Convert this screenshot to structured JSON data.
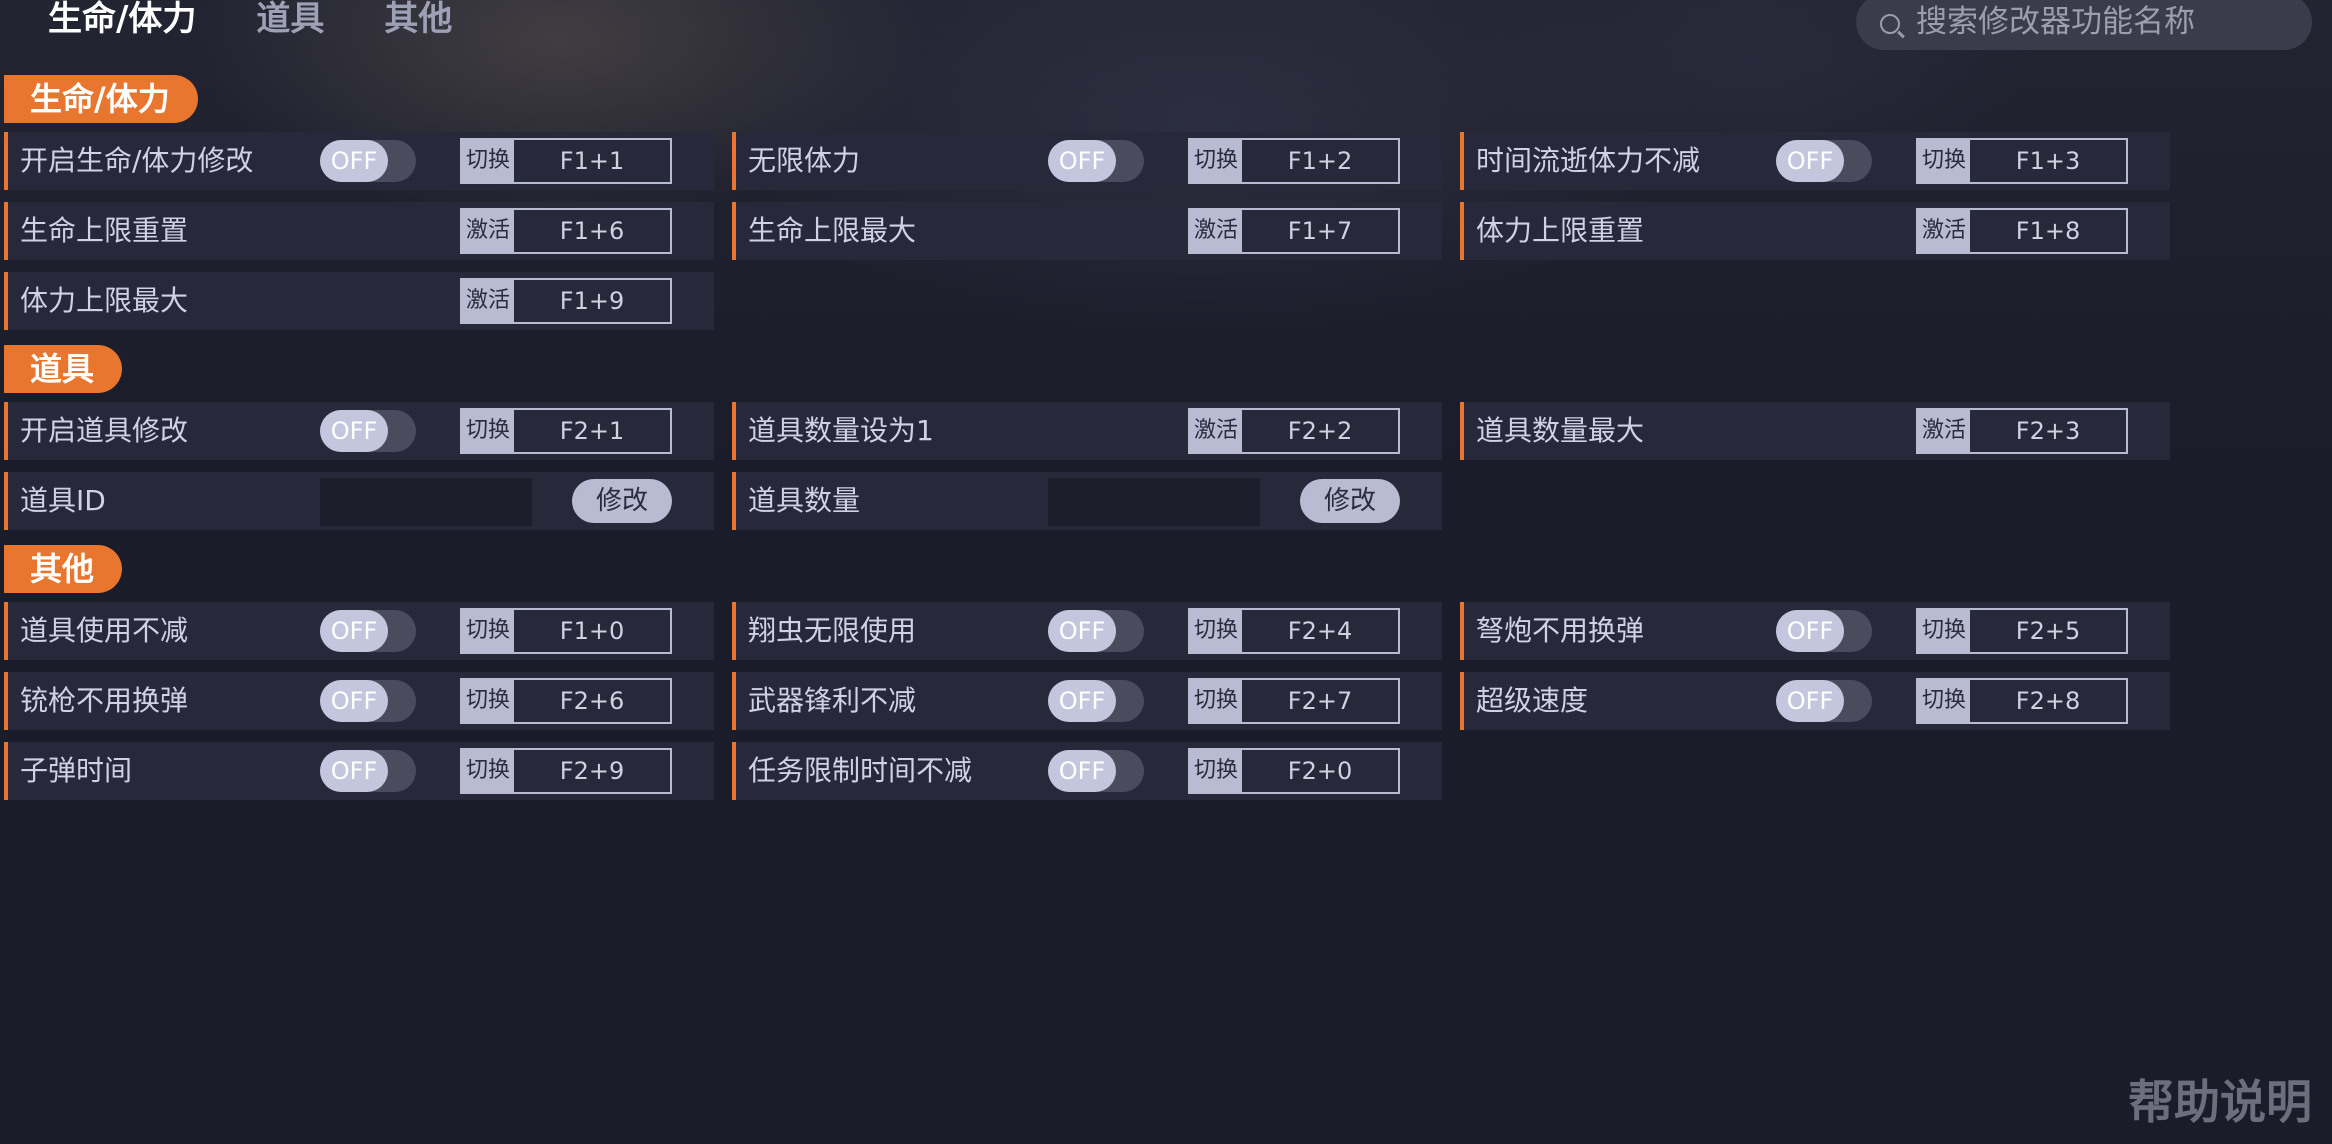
{
  "tabs": [
    "生命/体力",
    "道具",
    "其他"
  ],
  "search": {
    "placeholder": "搜索修改器功能名称"
  },
  "help": "帮助说明",
  "toggle_off": "OFF",
  "switch_label": "切换",
  "activate_label": "激活",
  "modify_label": "修改",
  "sections": {
    "life": {
      "title": "生命/体力",
      "rows": [
        {
          "label": "开启生命/体力修改",
          "type": "toggle",
          "action": "切换",
          "key": "F1+1"
        },
        {
          "label": "无限体力",
          "type": "toggle",
          "action": "切换",
          "key": "F1+2"
        },
        {
          "label": "时间流逝体力不减",
          "type": "toggle",
          "action": "切换",
          "key": "F1+3"
        },
        {
          "label": "生命上限重置",
          "type": "button",
          "action": "激活",
          "key": "F1+6"
        },
        {
          "label": "生命上限最大",
          "type": "button",
          "action": "激活",
          "key": "F1+7"
        },
        {
          "label": "体力上限重置",
          "type": "button",
          "action": "激活",
          "key": "F1+8"
        },
        {
          "label": "体力上限最大",
          "type": "button",
          "action": "激活",
          "key": "F1+9"
        }
      ]
    },
    "items": {
      "title": "道具",
      "rows": [
        {
          "label": "开启道具修改",
          "type": "toggle",
          "action": "切换",
          "key": "F2+1"
        },
        {
          "label": "道具数量设为1",
          "type": "button",
          "action": "激活",
          "key": "F2+2"
        },
        {
          "label": "道具数量最大",
          "type": "button",
          "action": "激活",
          "key": "F2+3"
        },
        {
          "label": "道具ID",
          "type": "input",
          "value": ""
        },
        {
          "label": "道具数量",
          "type": "input",
          "value": ""
        }
      ]
    },
    "other": {
      "title": "其他",
      "rows": [
        {
          "label": "道具使用不减",
          "type": "toggle",
          "action": "切换",
          "key": "F1+0"
        },
        {
          "label": "翔虫无限使用",
          "type": "toggle",
          "action": "切换",
          "key": "F2+4"
        },
        {
          "label": "弩炮不用换弹",
          "type": "toggle",
          "action": "切换",
          "key": "F2+5"
        },
        {
          "label": "铳枪不用换弹",
          "type": "toggle",
          "action": "切换",
          "key": "F2+6"
        },
        {
          "label": "武器锋利不减",
          "type": "toggle",
          "action": "切换",
          "key": "F2+7"
        },
        {
          "label": "超级速度",
          "type": "toggle",
          "action": "切换",
          "key": "F2+8"
        },
        {
          "label": "子弹时间",
          "type": "toggle",
          "action": "切换",
          "key": "F2+9"
        },
        {
          "label": "任务限制时间不减",
          "type": "toggle",
          "action": "切换",
          "key": "F2+0"
        }
      ]
    }
  }
}
